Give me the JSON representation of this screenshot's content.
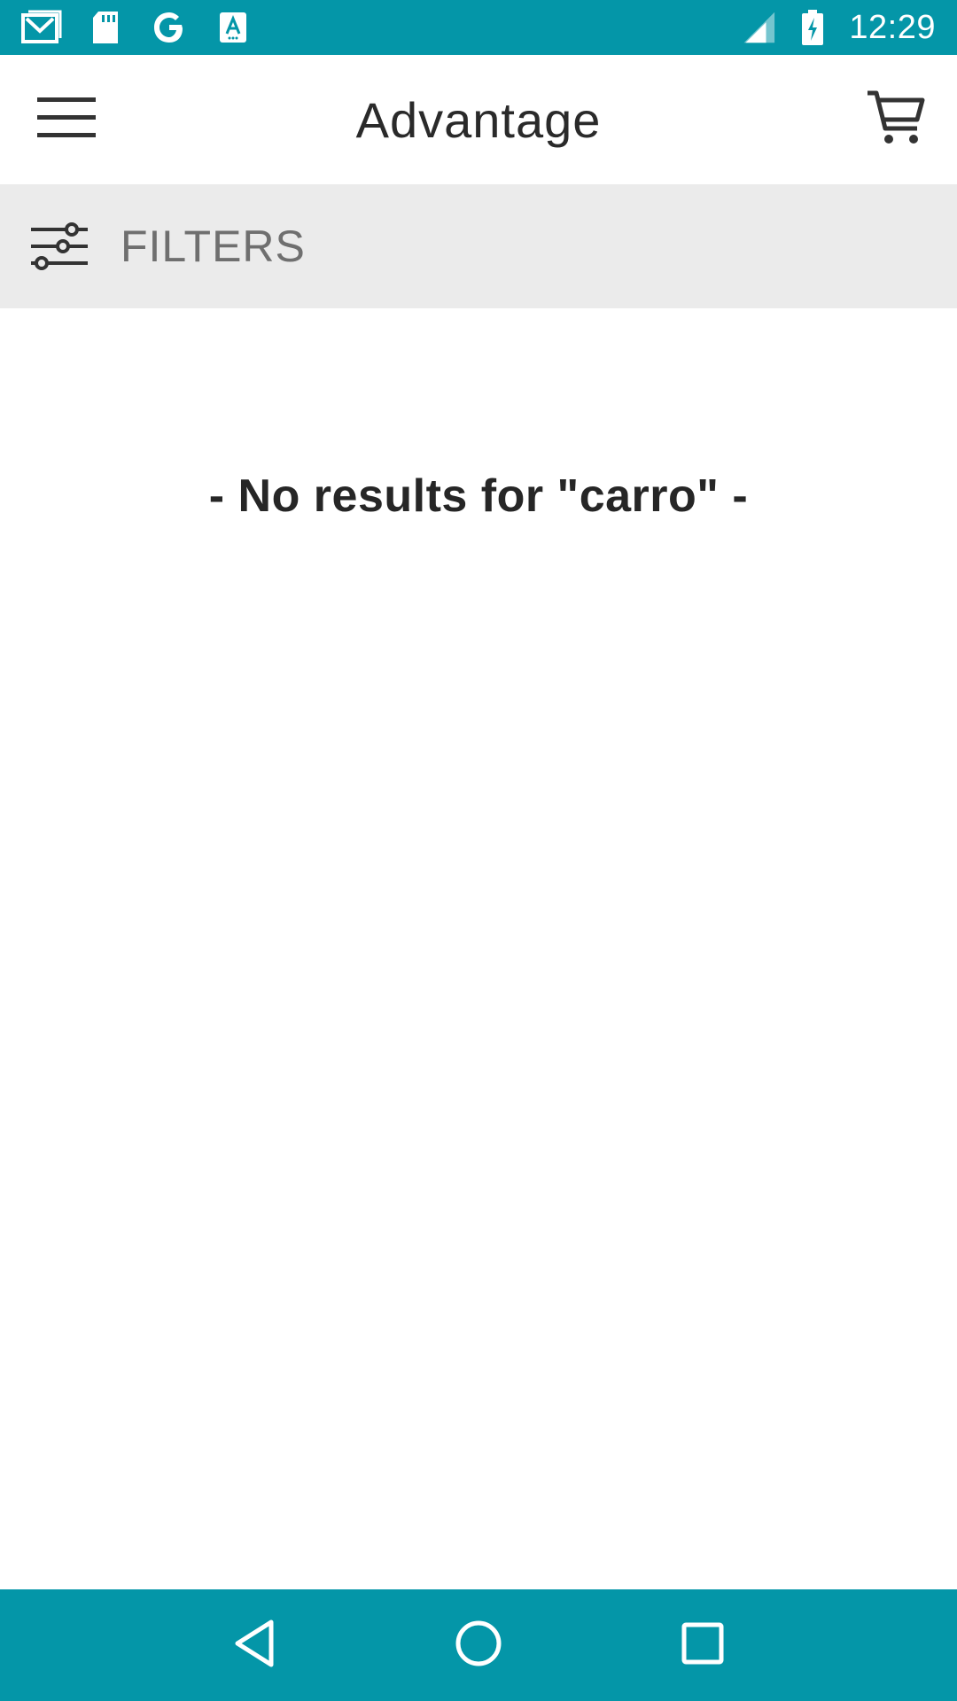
{
  "status_bar": {
    "time": "12:29",
    "network": "LTE",
    "left_icons": [
      "gmail-icon",
      "sd-card-icon",
      "google-icon",
      "text-a-icon"
    ],
    "right_icons": [
      "lte-signal-icon",
      "battery-charging-icon"
    ],
    "color": "#0496a8"
  },
  "app_bar": {
    "title": "Advantage",
    "left_icon": "menu-icon",
    "right_icon": "cart-icon"
  },
  "filters": {
    "label": "FILTERS",
    "icon": "sliders-icon"
  },
  "main": {
    "message": "- No results for \"carro\" -"
  },
  "nav_bar": {
    "buttons": [
      "back-icon",
      "home-icon",
      "recents-icon"
    ],
    "color": "#0496a8"
  }
}
